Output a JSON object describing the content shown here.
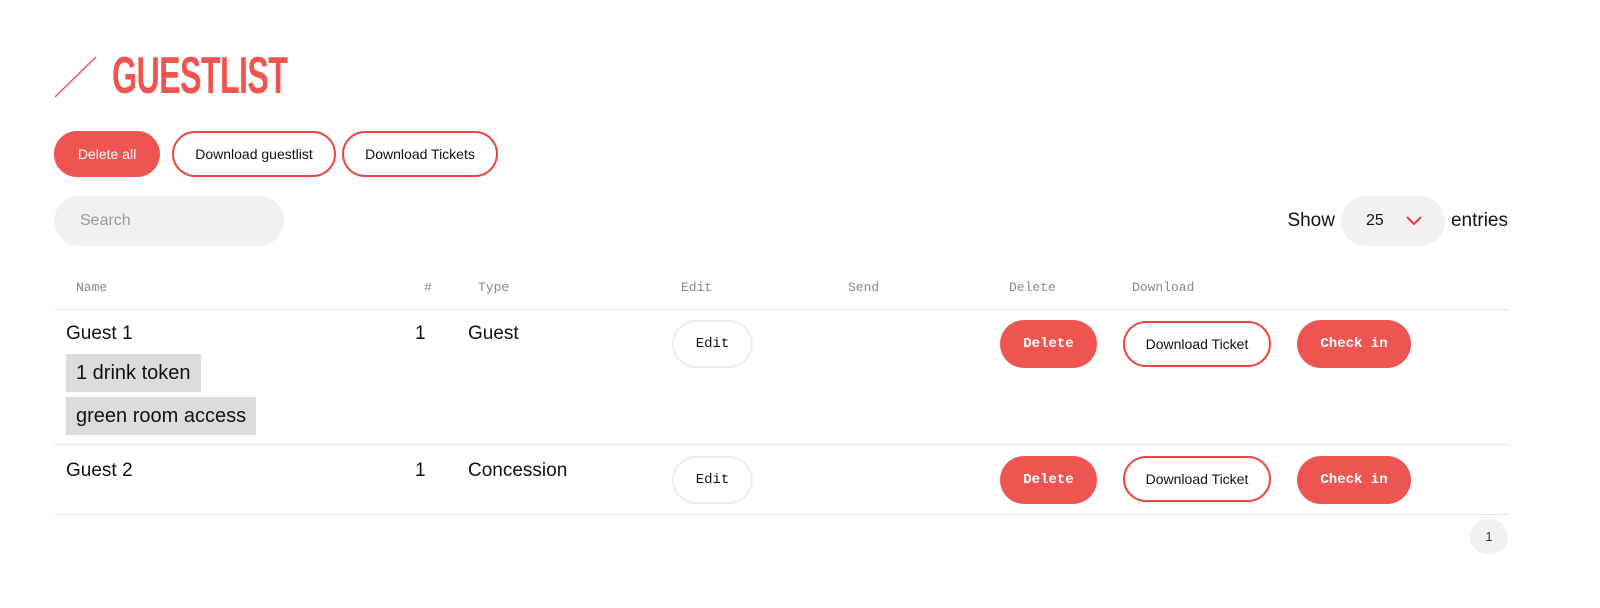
{
  "header": {
    "title": "GUESTLIST",
    "accent_color": "#ee5550",
    "icon": "slash-icon"
  },
  "actions": {
    "delete_all": "Delete all",
    "download_guestlist": "Download guestlist",
    "download_tickets": "Download Tickets"
  },
  "search": {
    "placeholder": "Search",
    "value": ""
  },
  "entries": {
    "show_label": "Show",
    "selected": "25",
    "suffix": "entries",
    "icon": "chevron-down-icon"
  },
  "table": {
    "columns": [
      "Name",
      "#",
      "Type",
      "Edit",
      "Send",
      "Delete",
      "Download"
    ],
    "rows": [
      {
        "name": "Guest 1",
        "count": "1",
        "type": "Guest",
        "extras": [
          "1 drink token",
          "green room access"
        ],
        "edit_label": "Edit",
        "delete_label": "Delete",
        "download_label": "Download Ticket",
        "checkin_label": "Check in"
      },
      {
        "name": "Guest 2",
        "count": "1",
        "type": "Concession",
        "extras": [],
        "edit_label": "Edit",
        "delete_label": "Delete",
        "download_label": "Download Ticket",
        "checkin_label": "Check in"
      }
    ]
  },
  "pagination": {
    "current_page": "1"
  }
}
